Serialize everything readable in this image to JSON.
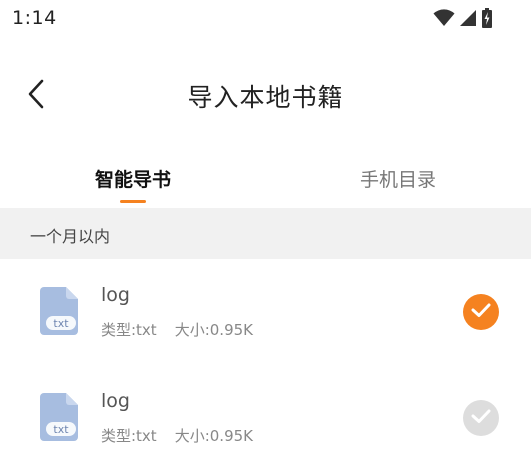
{
  "status_bar": {
    "time": "1:14",
    "icons": [
      "wifi-icon",
      "cellular-signal-icon",
      "battery-charging-icon"
    ]
  },
  "header": {
    "back_icon": "chevron-left-icon",
    "title": "导入本地书籍"
  },
  "tabs": [
    {
      "label": "智能导书",
      "active": true
    },
    {
      "label": "手机目录",
      "active": false
    }
  ],
  "section": {
    "label": "一个月以内"
  },
  "files": [
    {
      "icon": "txt-file-icon",
      "icon_badge": "txt",
      "name": "log",
      "type_text": "类型:txt",
      "size_text": "大小:0.95K",
      "selected": true
    },
    {
      "icon": "txt-file-icon",
      "icon_badge": "txt",
      "name": "log",
      "type_text": "类型:txt",
      "size_text": "大小:0.95K",
      "selected": false
    }
  ],
  "colors": {
    "accent": "#f58220",
    "file_icon": "#a7bde0",
    "unchecked": "#dddddd",
    "section_bg": "#f1f1f1"
  }
}
